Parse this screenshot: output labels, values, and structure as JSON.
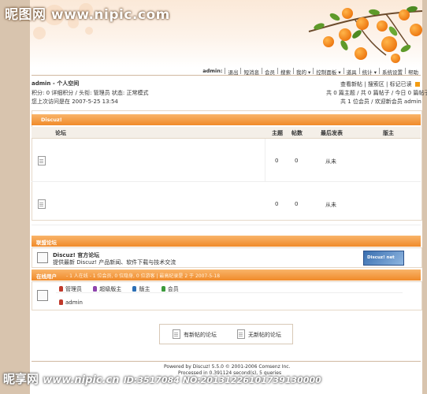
{
  "watermark": {
    "top": "昵图网 www.nipic.com",
    "bottom_brand": "昵享网",
    "bottom_url": "www.nipic.cn",
    "bottom_id": "ID:3517084 NO:20131226101739130000"
  },
  "header": {
    "topnav": [
      "admin:",
      "退出",
      "短消息",
      "会员",
      "搜索",
      "我的 ▾",
      "控制面板 ▾",
      "道具",
      "统计 ▾",
      "系统设置",
      "帮助"
    ]
  },
  "user": {
    "title": "admin - 个人空间",
    "points_line": "积分: 0 详细积分 / 头衔: 管理员 状态: 正常模式",
    "last_visit": "您上次访问是在 2007-5-25 13:54",
    "right_links": [
      "查看新帖",
      "搜索区",
      "标记已读"
    ],
    "stats_line1": "共 0 篇主题 / 共 0 篇帖子 / 今日 0 篇帖子",
    "stats_line2": "共 1 位会员 / 欢迎新会员 admin"
  },
  "forum_section": {
    "title": "Discuz!",
    "columns": {
      "forum": "论坛",
      "topics": "主题",
      "posts": "帖数",
      "last_post": "最后发表",
      "moderator": "版主"
    },
    "rows": [
      {
        "topics": "0",
        "posts": "0",
        "last_post": "从未"
      },
      {
        "topics": "0",
        "posts": "0",
        "last_post": "从未"
      }
    ]
  },
  "links_section": {
    "title": "联盟论坛",
    "name": "Discuz! 官方论坛",
    "desc": "提供最新 Discuz! 产品新闻、软件下载与技术交流",
    "logo_text": "Discuz! net"
  },
  "online_section": {
    "title": "在线用户",
    "summary": "- 1 人在线 - 1 位会员, 0 位隐身, 0 位游客 | 最高纪录是 2 于 2007-5-18",
    "legend": [
      "管理员",
      "超级版主",
      "版主",
      "会员"
    ],
    "legend_colors": [
      "#c0392b",
      "#8e44ad",
      "#2c6fb5",
      "#3c9a3c"
    ],
    "user": "admin"
  },
  "footer_links": {
    "new": "有新帖的论坛",
    "none": "无新帖的论坛"
  },
  "footer": {
    "powered": "Powered by Discuz! 5.5.0 © 2001-2006 Comsenz Inc.",
    "processed": "Processed in 0.391124 second(s), 5 queries"
  }
}
